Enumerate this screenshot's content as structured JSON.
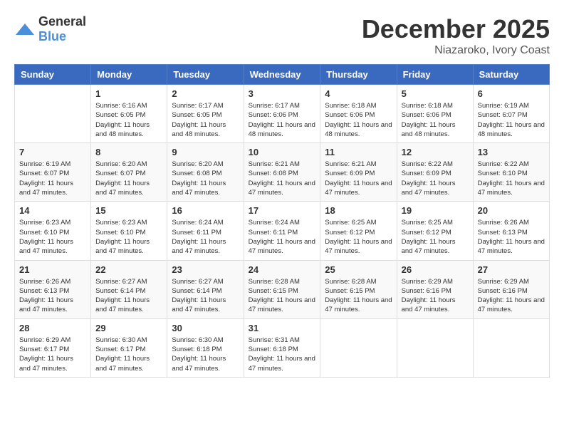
{
  "logo": {
    "general": "General",
    "blue": "Blue"
  },
  "title": {
    "month": "December 2025",
    "location": "Niazaroko, Ivory Coast"
  },
  "headers": [
    "Sunday",
    "Monday",
    "Tuesday",
    "Wednesday",
    "Thursday",
    "Friday",
    "Saturday"
  ],
  "weeks": [
    [
      {
        "day": "",
        "empty": true
      },
      {
        "day": "1",
        "sunrise": "Sunrise: 6:16 AM",
        "sunset": "Sunset: 6:05 PM",
        "daylight": "Daylight: 11 hours and 48 minutes."
      },
      {
        "day": "2",
        "sunrise": "Sunrise: 6:17 AM",
        "sunset": "Sunset: 6:05 PM",
        "daylight": "Daylight: 11 hours and 48 minutes."
      },
      {
        "day": "3",
        "sunrise": "Sunrise: 6:17 AM",
        "sunset": "Sunset: 6:06 PM",
        "daylight": "Daylight: 11 hours and 48 minutes."
      },
      {
        "day": "4",
        "sunrise": "Sunrise: 6:18 AM",
        "sunset": "Sunset: 6:06 PM",
        "daylight": "Daylight: 11 hours and 48 minutes."
      },
      {
        "day": "5",
        "sunrise": "Sunrise: 6:18 AM",
        "sunset": "Sunset: 6:06 PM",
        "daylight": "Daylight: 11 hours and 48 minutes."
      },
      {
        "day": "6",
        "sunrise": "Sunrise: 6:19 AM",
        "sunset": "Sunset: 6:07 PM",
        "daylight": "Daylight: 11 hours and 48 minutes."
      }
    ],
    [
      {
        "day": "7",
        "sunrise": "Sunrise: 6:19 AM",
        "sunset": "Sunset: 6:07 PM",
        "daylight": "Daylight: 11 hours and 47 minutes."
      },
      {
        "day": "8",
        "sunrise": "Sunrise: 6:20 AM",
        "sunset": "Sunset: 6:07 PM",
        "daylight": "Daylight: 11 hours and 47 minutes."
      },
      {
        "day": "9",
        "sunrise": "Sunrise: 6:20 AM",
        "sunset": "Sunset: 6:08 PM",
        "daylight": "Daylight: 11 hours and 47 minutes."
      },
      {
        "day": "10",
        "sunrise": "Sunrise: 6:21 AM",
        "sunset": "Sunset: 6:08 PM",
        "daylight": "Daylight: 11 hours and 47 minutes."
      },
      {
        "day": "11",
        "sunrise": "Sunrise: 6:21 AM",
        "sunset": "Sunset: 6:09 PM",
        "daylight": "Daylight: 11 hours and 47 minutes."
      },
      {
        "day": "12",
        "sunrise": "Sunrise: 6:22 AM",
        "sunset": "Sunset: 6:09 PM",
        "daylight": "Daylight: 11 hours and 47 minutes."
      },
      {
        "day": "13",
        "sunrise": "Sunrise: 6:22 AM",
        "sunset": "Sunset: 6:10 PM",
        "daylight": "Daylight: 11 hours and 47 minutes."
      }
    ],
    [
      {
        "day": "14",
        "sunrise": "Sunrise: 6:23 AM",
        "sunset": "Sunset: 6:10 PM",
        "daylight": "Daylight: 11 hours and 47 minutes."
      },
      {
        "day": "15",
        "sunrise": "Sunrise: 6:23 AM",
        "sunset": "Sunset: 6:10 PM",
        "daylight": "Daylight: 11 hours and 47 minutes."
      },
      {
        "day": "16",
        "sunrise": "Sunrise: 6:24 AM",
        "sunset": "Sunset: 6:11 PM",
        "daylight": "Daylight: 11 hours and 47 minutes."
      },
      {
        "day": "17",
        "sunrise": "Sunrise: 6:24 AM",
        "sunset": "Sunset: 6:11 PM",
        "daylight": "Daylight: 11 hours and 47 minutes."
      },
      {
        "day": "18",
        "sunrise": "Sunrise: 6:25 AM",
        "sunset": "Sunset: 6:12 PM",
        "daylight": "Daylight: 11 hours and 47 minutes."
      },
      {
        "day": "19",
        "sunrise": "Sunrise: 6:25 AM",
        "sunset": "Sunset: 6:12 PM",
        "daylight": "Daylight: 11 hours and 47 minutes."
      },
      {
        "day": "20",
        "sunrise": "Sunrise: 6:26 AM",
        "sunset": "Sunset: 6:13 PM",
        "daylight": "Daylight: 11 hours and 47 minutes."
      }
    ],
    [
      {
        "day": "21",
        "sunrise": "Sunrise: 6:26 AM",
        "sunset": "Sunset: 6:13 PM",
        "daylight": "Daylight: 11 hours and 47 minutes."
      },
      {
        "day": "22",
        "sunrise": "Sunrise: 6:27 AM",
        "sunset": "Sunset: 6:14 PM",
        "daylight": "Daylight: 11 hours and 47 minutes."
      },
      {
        "day": "23",
        "sunrise": "Sunrise: 6:27 AM",
        "sunset": "Sunset: 6:14 PM",
        "daylight": "Daylight: 11 hours and 47 minutes."
      },
      {
        "day": "24",
        "sunrise": "Sunrise: 6:28 AM",
        "sunset": "Sunset: 6:15 PM",
        "daylight": "Daylight: 11 hours and 47 minutes."
      },
      {
        "day": "25",
        "sunrise": "Sunrise: 6:28 AM",
        "sunset": "Sunset: 6:15 PM",
        "daylight": "Daylight: 11 hours and 47 minutes."
      },
      {
        "day": "26",
        "sunrise": "Sunrise: 6:29 AM",
        "sunset": "Sunset: 6:16 PM",
        "daylight": "Daylight: 11 hours and 47 minutes."
      },
      {
        "day": "27",
        "sunrise": "Sunrise: 6:29 AM",
        "sunset": "Sunset: 6:16 PM",
        "daylight": "Daylight: 11 hours and 47 minutes."
      }
    ],
    [
      {
        "day": "28",
        "sunrise": "Sunrise: 6:29 AM",
        "sunset": "Sunset: 6:17 PM",
        "daylight": "Daylight: 11 hours and 47 minutes."
      },
      {
        "day": "29",
        "sunrise": "Sunrise: 6:30 AM",
        "sunset": "Sunset: 6:17 PM",
        "daylight": "Daylight: 11 hours and 47 minutes."
      },
      {
        "day": "30",
        "sunrise": "Sunrise: 6:30 AM",
        "sunset": "Sunset: 6:18 PM",
        "daylight": "Daylight: 11 hours and 47 minutes."
      },
      {
        "day": "31",
        "sunrise": "Sunrise: 6:31 AM",
        "sunset": "Sunset: 6:18 PM",
        "daylight": "Daylight: 11 hours and 47 minutes."
      },
      {
        "day": "",
        "empty": true
      },
      {
        "day": "",
        "empty": true
      },
      {
        "day": "",
        "empty": true
      }
    ]
  ]
}
